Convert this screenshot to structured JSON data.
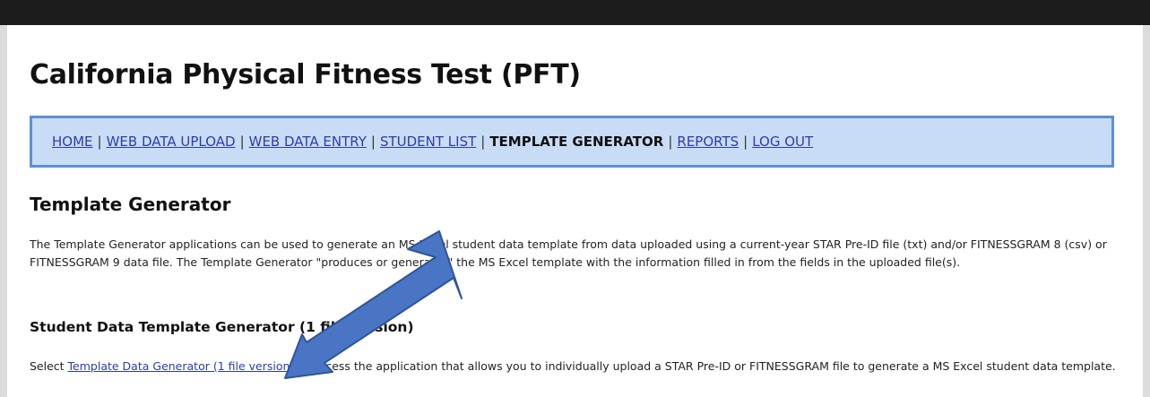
{
  "page": {
    "title": "California Physical Fitness Test (PFT)"
  },
  "nav": {
    "items": [
      {
        "label": "HOME",
        "current": false
      },
      {
        "label": "WEB DATA UPLOAD",
        "current": false
      },
      {
        "label": "WEB DATA ENTRY",
        "current": false
      },
      {
        "label": "STUDENT LIST",
        "current": false
      },
      {
        "label": "TEMPLATE GENERATOR",
        "current": true
      },
      {
        "label": "REPORTS",
        "current": false
      },
      {
        "label": "LOG OUT",
        "current": false
      }
    ],
    "separator": "|"
  },
  "section": {
    "title": "Template Generator",
    "description": "The Template Generator applications can be used to generate an MS Excel student data template from data uploaded using a current-year STAR Pre-ID file (txt) and/or FITNESSGRAM 8 (csv) or FITNESSGRAM 9 data file. The Template Generator \"produces or generates\" the MS Excel template with the information filled in from the fields in the uploaded file(s)."
  },
  "subsection": {
    "title": "Student Data Template Generator (1 file version)",
    "text_before": "Select ",
    "link_label": "Template Data Generator (1 file version)",
    "text_after": " to access the application that allows you to individually upload a STAR Pre-ID or FITNESSGRAM file to generate a MS Excel student data template."
  },
  "colors": {
    "nav_background": "#c9dcf5",
    "nav_border": "#5d8fd6",
    "link": "#2a3fa8",
    "arrow_fill": "#4a74c4",
    "arrow_stroke": "#2f5597"
  }
}
